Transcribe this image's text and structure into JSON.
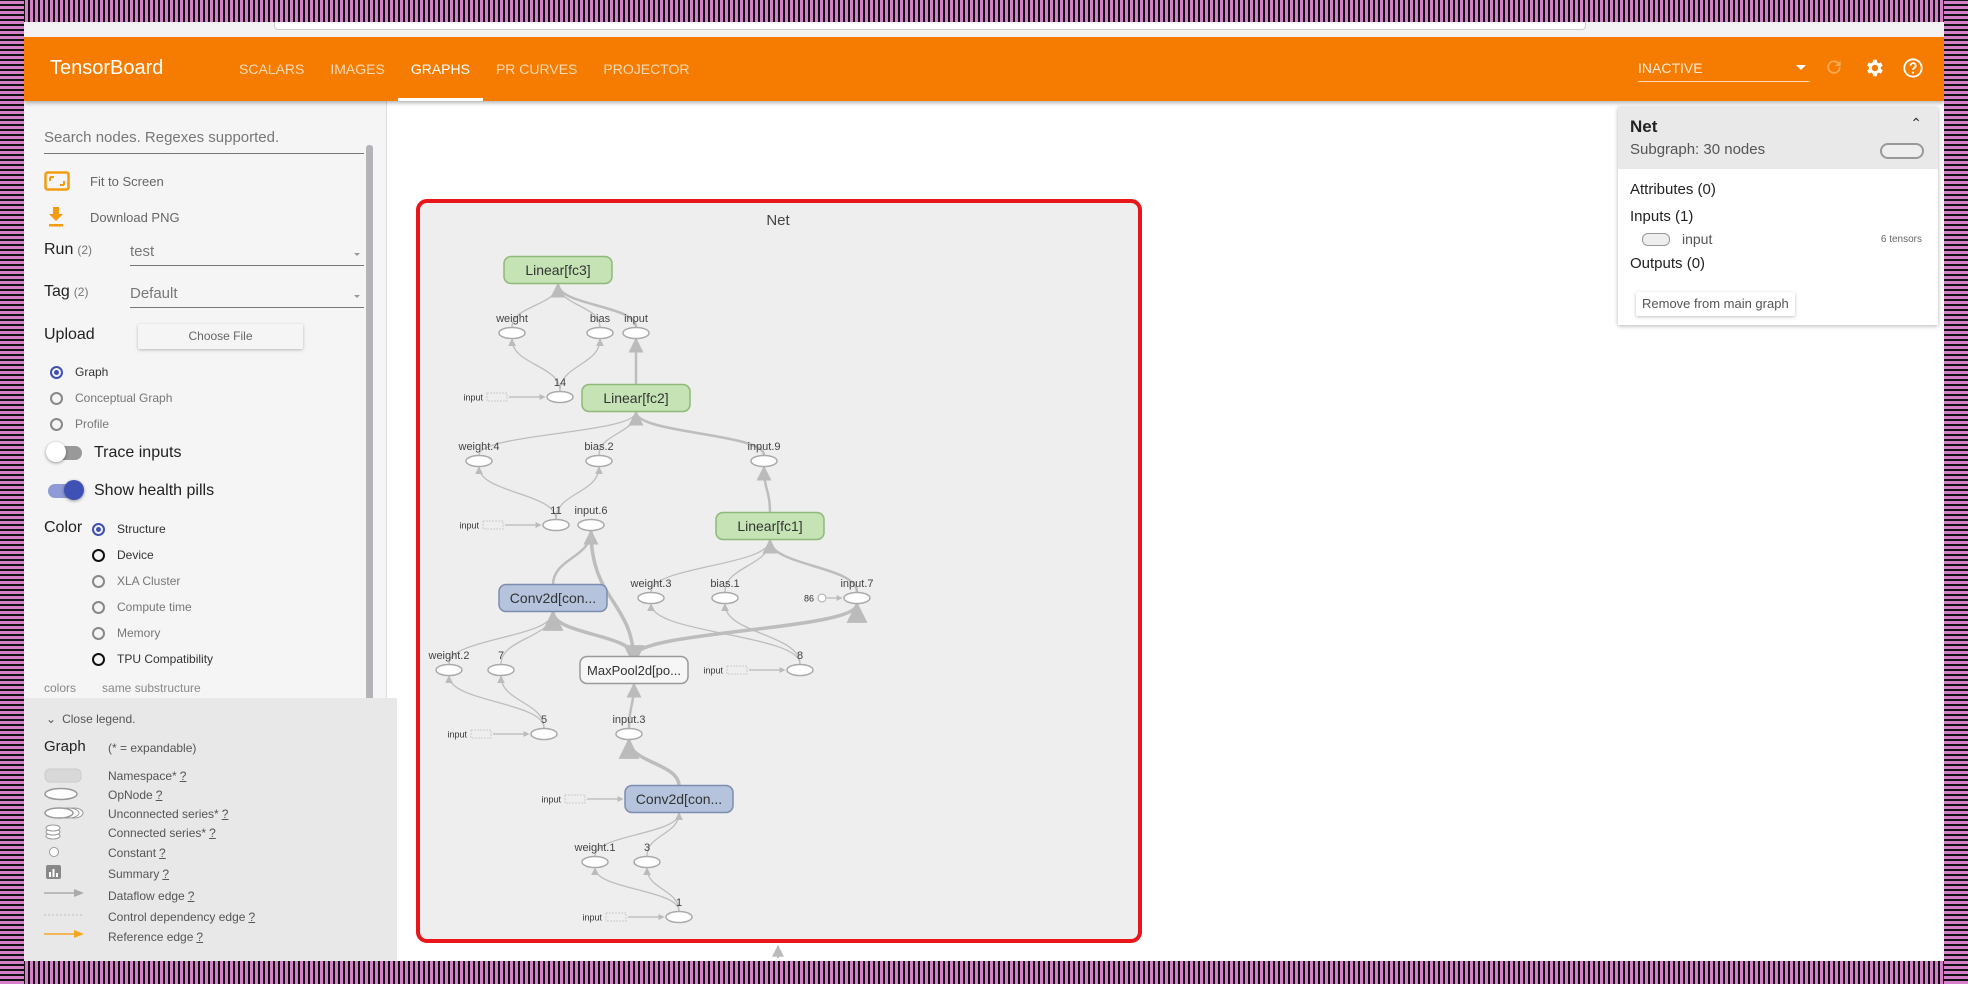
{
  "app": {
    "brand": "TensorBoard"
  },
  "tabs": [
    {
      "label": "SCALARS",
      "active": false
    },
    {
      "label": "IMAGES",
      "active": false
    },
    {
      "label": "GRAPHS",
      "active": true
    },
    {
      "label": "PR CURVES",
      "active": false
    },
    {
      "label": "PROJECTOR",
      "active": false
    }
  ],
  "toolbar": {
    "run_status": "INACTIVE",
    "icons": [
      "refresh-icon",
      "settings-icon",
      "help-icon"
    ]
  },
  "sidebar": {
    "search_placeholder": "Search nodes. Regexes supported.",
    "fit_to_screen": "Fit to Screen",
    "download_png": "Download PNG",
    "run_label": "Run",
    "run_count": "(2)",
    "run_value": "test",
    "tag_label": "Tag",
    "tag_count": "(2)",
    "tag_value": "Default",
    "upload_label": "Upload",
    "choose_file": "Choose File",
    "graph_modes": [
      {
        "label": "Graph",
        "selected": true
      },
      {
        "label": "Conceptual Graph",
        "selected": false
      },
      {
        "label": "Profile",
        "selected": false
      }
    ],
    "trace_inputs": {
      "label": "Trace inputs",
      "on": false
    },
    "health_pills": {
      "label": "Show health pills",
      "on": true
    },
    "color_label": "Color",
    "color_options": [
      {
        "label": "Structure",
        "selected": true
      },
      {
        "label": "Device",
        "selected": false
      },
      {
        "label": "XLA Cluster",
        "selected": false
      },
      {
        "label": "Compute time",
        "selected": false
      },
      {
        "label": "Memory",
        "selected": false
      },
      {
        "label": "TPU Compatibility",
        "selected": false
      }
    ],
    "colors_foot_left": "colors",
    "colors_foot_right": "same substructure"
  },
  "legend": {
    "close": "Close legend.",
    "title": "Graph",
    "subtitle": "(* = expandable)",
    "items": [
      {
        "label": "Namespace*",
        "help": "?"
      },
      {
        "label": "OpNode",
        "help": "?"
      },
      {
        "label": "Unconnected series*",
        "help": "?"
      },
      {
        "label": "Connected series*",
        "help": "?"
      },
      {
        "label": "Constant",
        "help": "?"
      },
      {
        "label": "Summary",
        "help": "?"
      },
      {
        "label": "Dataflow edge",
        "help": "?"
      },
      {
        "label": "Control dependency edge",
        "help": "?"
      },
      {
        "label": "Reference edge",
        "help": "?"
      }
    ]
  },
  "info": {
    "title": "Net",
    "subtitle": "Subgraph: 30 nodes",
    "attributes": "Attributes (0)",
    "inputs": "Inputs (1)",
    "input_name": "input",
    "input_tensors": "6 tensors",
    "outputs": "Outputs (0)",
    "remove": "Remove from main graph"
  },
  "graph": {
    "title": "Net",
    "colors": {
      "linear": "#c5e3b5",
      "linear_border": "#8fb87a",
      "conv": "#b5c3dd",
      "conv_border": "#7d8db0",
      "frame": "#e8161b"
    },
    "namespaces": [
      {
        "id": "fc3",
        "label": "Linear[fc3]",
        "kind": "linear"
      },
      {
        "id": "fc2",
        "label": "Linear[fc2]",
        "kind": "linear"
      },
      {
        "id": "fc1",
        "label": "Linear[fc1]",
        "kind": "linear"
      },
      {
        "id": "conv2",
        "label": "Conv2d[con...",
        "kind": "conv"
      },
      {
        "id": "conv1",
        "label": "Conv2d[con...",
        "kind": "conv"
      },
      {
        "id": "pool",
        "label": "MaxPool2d[po...",
        "kind": "plain"
      }
    ],
    "ops": [
      {
        "id": "weight",
        "label": "weight"
      },
      {
        "id": "bias",
        "label": "bias"
      },
      {
        "id": "input",
        "label": "input"
      },
      {
        "id": "n14",
        "label": "14"
      },
      {
        "id": "weight4",
        "label": "weight.4"
      },
      {
        "id": "bias2",
        "label": "bias.2"
      },
      {
        "id": "input9",
        "label": "input.9"
      },
      {
        "id": "n11",
        "label": "11"
      },
      {
        "id": "input6",
        "label": "input.6"
      },
      {
        "id": "weight3",
        "label": "weight.3"
      },
      {
        "id": "bias1",
        "label": "bias.1"
      },
      {
        "id": "input7",
        "label": "input.7"
      },
      {
        "id": "weight2",
        "label": "weight.2"
      },
      {
        "id": "n7",
        "label": "7"
      },
      {
        "id": "n8",
        "label": "8"
      },
      {
        "id": "n5",
        "label": "5"
      },
      {
        "id": "input3",
        "label": "input.3"
      },
      {
        "id": "weight1",
        "label": "weight.1"
      },
      {
        "id": "n3",
        "label": "3"
      },
      {
        "id": "n1",
        "label": "1"
      }
    ],
    "constant": {
      "id": "c86",
      "label": "86"
    },
    "input_stub_label": "input"
  }
}
